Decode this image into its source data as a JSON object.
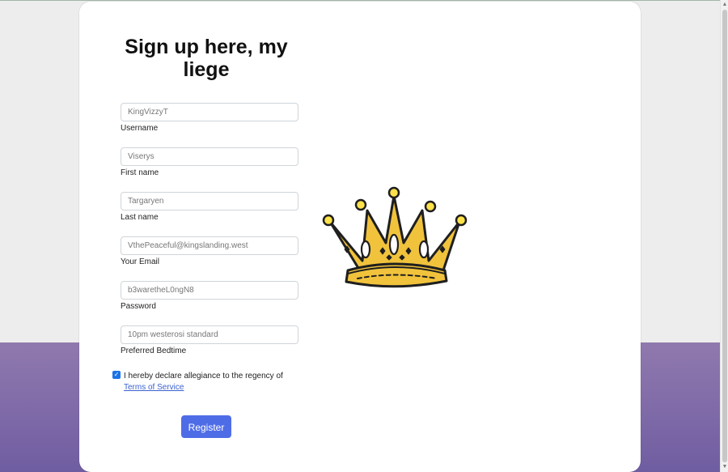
{
  "title": "Sign up here, my liege",
  "fields": [
    {
      "value": "KingVizzyT",
      "label": "Username"
    },
    {
      "value": "Viserys",
      "label": "First name"
    },
    {
      "value": "Targaryen",
      "label": "Last name"
    },
    {
      "value": "VthePeaceful@kingslanding.west",
      "label": "Your Email"
    },
    {
      "value": "b3waretheL0ngN8",
      "label": "Password"
    },
    {
      "value": "10pm westerosi standard",
      "label": "Preferred Bedtime"
    }
  ],
  "terms": {
    "checked": true,
    "text": "I hereby declare allegiance to the regency of ",
    "link": "Terms of Service"
  },
  "register_label": "Register",
  "colors": {
    "background_light": "#ededed",
    "background_purple": "#7f6aa8",
    "primary_button": "#4f6ce7",
    "link": "#3b63d1"
  },
  "icons": {
    "crown": "crown-illustration",
    "checkbox": "checkmark-icon"
  }
}
